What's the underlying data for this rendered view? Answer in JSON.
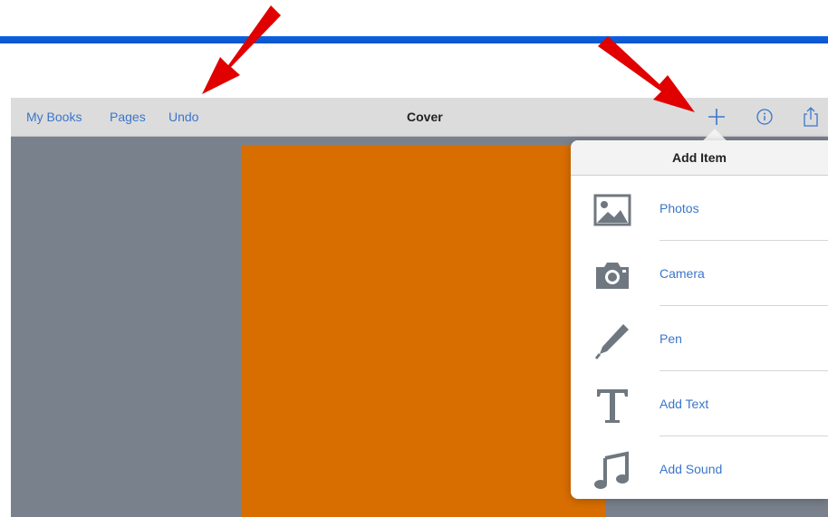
{
  "toolbar": {
    "my_books_label": "My Books",
    "pages_label": "Pages",
    "undo_label": "Undo",
    "title": "Cover",
    "icons": [
      "plus-icon",
      "info-icon",
      "share-icon"
    ]
  },
  "popover": {
    "title": "Add Item",
    "items": [
      {
        "label": "Photos",
        "icon": "photos-icon"
      },
      {
        "label": "Camera",
        "icon": "camera-icon"
      },
      {
        "label": "Pen",
        "icon": "pen-icon"
      },
      {
        "label": "Add Text",
        "icon": "text-icon"
      },
      {
        "label": "Add Sound",
        "icon": "sound-icon"
      }
    ]
  },
  "colors": {
    "accent": "#3b76c9",
    "page": "#d96e00",
    "background": "#79818d",
    "annotation_arrow": "#e00000",
    "top_rule": "#0a62e6"
  }
}
